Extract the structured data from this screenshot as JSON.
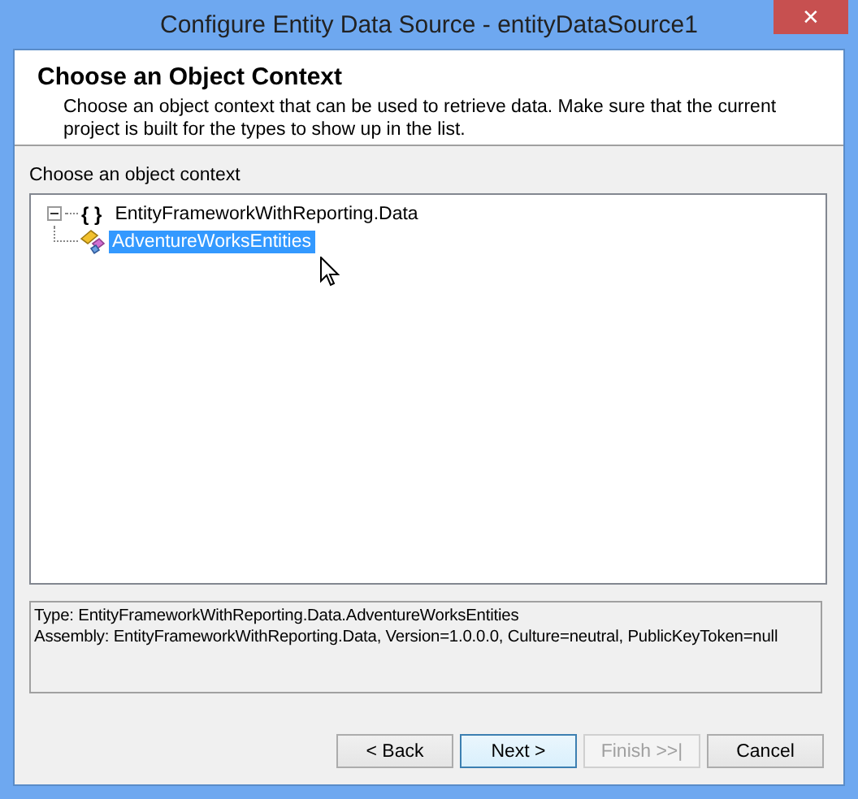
{
  "window": {
    "title": "Configure Entity Data Source - entityDataSource1",
    "close": "✕"
  },
  "header": {
    "title": "Choose an Object Context",
    "description": "Choose an object context that can be used to retrieve data. Make sure that the current project is built for the types to show up in the list."
  },
  "tree": {
    "label": "Choose an object context",
    "items": [
      {
        "label": "EntityFrameworkWithReporting.Data",
        "icon": "{ }",
        "expanded": true,
        "selected": false,
        "children": [
          {
            "label": "AdventureWorksEntities",
            "selected": true
          }
        ]
      }
    ]
  },
  "details": [
    "Type: EntityFrameworkWithReporting.Data.AdventureWorksEntities",
    "Assembly: EntityFrameworkWithReporting.Data, Version=1.0.0.0, Culture=neutral, PublicKeyToken=null"
  ],
  "buttons": [
    {
      "label": "< Back",
      "disabled": false,
      "default": false
    },
    {
      "label": "Next >",
      "disabled": false,
      "default": true
    },
    {
      "label": "Finish >>|",
      "disabled": true,
      "default": false
    },
    {
      "label": "Cancel",
      "disabled": false,
      "default": false
    }
  ]
}
